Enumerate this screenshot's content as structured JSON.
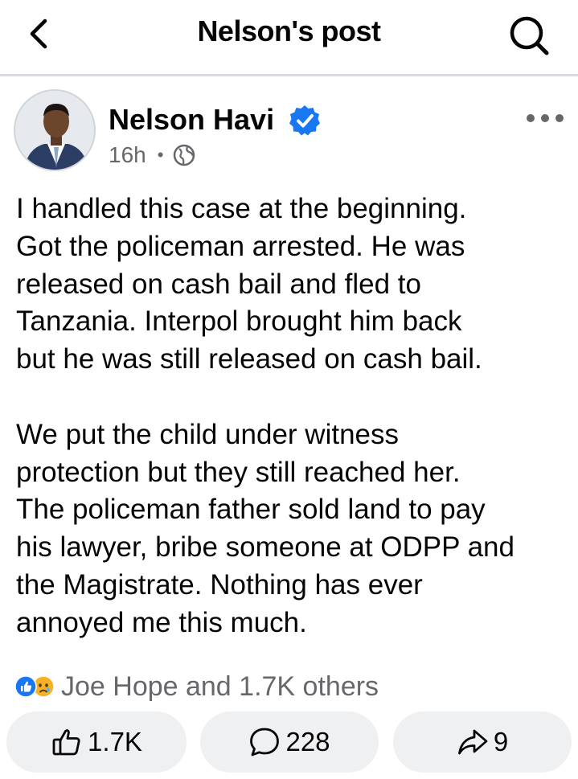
{
  "header": {
    "title": "Nelson's post",
    "back_icon": "chevron-left-icon",
    "search_icon": "search-icon"
  },
  "post": {
    "author": "Nelson Havi",
    "verified": true,
    "time": "16h",
    "separator": "•",
    "audience_icon": "globe-icon",
    "more_icon": "more-horizontal-icon",
    "paragraphs": [
      "I handled this case at the beginning.\nGot the policeman arrested. He was\nreleased on cash bail and fled to\nTanzania. Interpol brought him back\nbut he was still released on cash bail.",
      "We put the child under witness\nprotection but they still reached her.\nThe policeman father sold land to pay\nhis lawyer, bribe someone at ODPP and\nthe Magistrate. Nothing has ever\nannoyed me this much."
    ],
    "reactions_text": "Joe Hope and 1.7K others",
    "reaction_icons": [
      "like-reaction-icon",
      "sad-reaction-icon"
    ]
  },
  "actions": {
    "like_count": "1.7K",
    "comment_count": "228",
    "share_count": "9"
  },
  "colors": {
    "accent": "#1877f2",
    "secondary_text": "#65676b",
    "pill_bg": "#eff0f2",
    "sad_yellow": "#f7b125"
  }
}
